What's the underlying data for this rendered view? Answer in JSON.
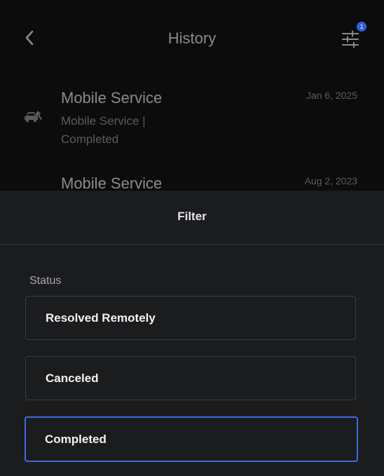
{
  "header": {
    "title": "History",
    "back_icon": "chevron-left-icon",
    "filter_icon": "sliders-icon",
    "filter_badge_count": "1"
  },
  "history": {
    "items": [
      {
        "title": "Mobile Service",
        "subtitle": "Mobile Service | Completed",
        "date": "Jan 6, 2025",
        "icon": "service-vehicle-icon"
      },
      {
        "title": "Mobile Service",
        "date": "Aug 2, 2023"
      }
    ]
  },
  "filter": {
    "title": "Filter",
    "status_label": "Status",
    "options": [
      {
        "label": "Resolved Remotely",
        "selected": false
      },
      {
        "label": "Canceled",
        "selected": false
      },
      {
        "label": "Completed",
        "selected": true
      }
    ]
  },
  "colors": {
    "accent": "#3e6ae1",
    "badge": "#2f5fd8",
    "sheet_background": "#1b1c1e"
  }
}
